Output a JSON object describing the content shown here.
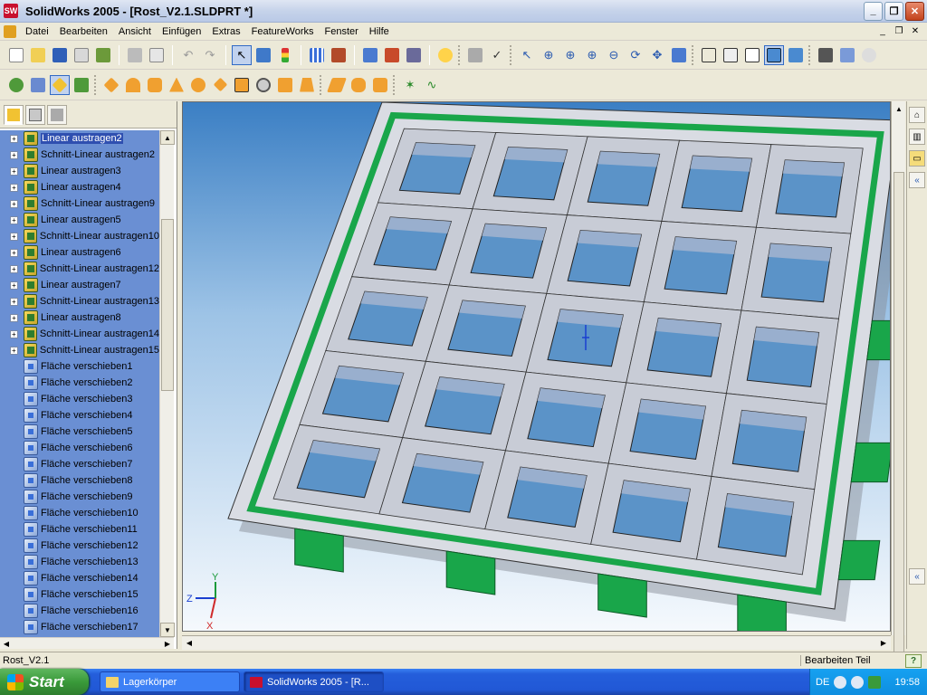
{
  "window": {
    "app_name": "SolidWorks 2005",
    "title": "SolidWorks 2005 - [Rost_V2.1.SLDPRT *]"
  },
  "menu": {
    "items": [
      "Datei",
      "Bearbeiten",
      "Ansicht",
      "Einfügen",
      "Extras",
      "FeatureWorks",
      "Fenster",
      "Hilfe"
    ]
  },
  "feature_tree": {
    "items": [
      {
        "label": "Linear austragen2",
        "expandable": true,
        "icon": "extrude-icon",
        "highlight": true
      },
      {
        "label": "Schnitt-Linear austragen2",
        "expandable": true,
        "icon": "cut-extrude-icon"
      },
      {
        "label": "Linear austragen3",
        "expandable": true,
        "icon": "extrude-icon"
      },
      {
        "label": "Linear austragen4",
        "expandable": true,
        "icon": "extrude-icon"
      },
      {
        "label": "Schnitt-Linear austragen9",
        "expandable": true,
        "icon": "cut-extrude-icon"
      },
      {
        "label": "Linear austragen5",
        "expandable": true,
        "icon": "extrude-icon"
      },
      {
        "label": "Schnitt-Linear austragen10",
        "expandable": true,
        "icon": "cut-extrude-icon"
      },
      {
        "label": "Linear austragen6",
        "expandable": true,
        "icon": "extrude-icon"
      },
      {
        "label": "Schnitt-Linear austragen12",
        "expandable": true,
        "icon": "cut-extrude-icon"
      },
      {
        "label": "Linear austragen7",
        "expandable": true,
        "icon": "extrude-icon"
      },
      {
        "label": "Schnitt-Linear austragen13",
        "expandable": true,
        "icon": "cut-extrude-icon"
      },
      {
        "label": "Linear austragen8",
        "expandable": true,
        "icon": "extrude-icon"
      },
      {
        "label": "Schnitt-Linear austragen14",
        "expandable": true,
        "icon": "cut-extrude-icon"
      },
      {
        "label": "Schnitt-Linear austragen15",
        "expandable": true,
        "icon": "cut-extrude-icon"
      },
      {
        "label": "Fläche verschieben1",
        "expandable": false,
        "icon": "move-face-icon"
      },
      {
        "label": "Fläche verschieben2",
        "expandable": false,
        "icon": "move-face-icon"
      },
      {
        "label": "Fläche verschieben3",
        "expandable": false,
        "icon": "move-face-icon"
      },
      {
        "label": "Fläche verschieben4",
        "expandable": false,
        "icon": "move-face-icon"
      },
      {
        "label": "Fläche verschieben5",
        "expandable": false,
        "icon": "move-face-icon"
      },
      {
        "label": "Fläche verschieben6",
        "expandable": false,
        "icon": "move-face-icon"
      },
      {
        "label": "Fläche verschieben7",
        "expandable": false,
        "icon": "move-face-icon"
      },
      {
        "label": "Fläche verschieben8",
        "expandable": false,
        "icon": "move-face-icon"
      },
      {
        "label": "Fläche verschieben9",
        "expandable": false,
        "icon": "move-face-icon"
      },
      {
        "label": "Fläche verschieben10",
        "expandable": false,
        "icon": "move-face-icon"
      },
      {
        "label": "Fläche verschieben11",
        "expandable": false,
        "icon": "move-face-icon"
      },
      {
        "label": "Fläche verschieben12",
        "expandable": false,
        "icon": "move-face-icon"
      },
      {
        "label": "Fläche verschieben13",
        "expandable": false,
        "icon": "move-face-icon"
      },
      {
        "label": "Fläche verschieben14",
        "expandable": false,
        "icon": "move-face-icon"
      },
      {
        "label": "Fläche verschieben15",
        "expandable": false,
        "icon": "move-face-icon"
      },
      {
        "label": "Fläche verschieben16",
        "expandable": false,
        "icon": "move-face-icon"
      },
      {
        "label": "Fläche verschieben17",
        "expandable": false,
        "icon": "move-face-icon"
      }
    ]
  },
  "viewport": {
    "model": "grate-part",
    "accent_green": "#19a64a",
    "axes": {
      "x": "X",
      "y": "Y",
      "z": "Z"
    }
  },
  "statusbar": {
    "left": "Rost_V2.1",
    "right": "Bearbeiten Teil",
    "help_icon": "?"
  },
  "taskbar": {
    "start_label": "Start",
    "tasks": [
      {
        "label": "Lagerkörper",
        "icon": "folder-icon",
        "active": false
      },
      {
        "label": "SolidWorks 2005 - [R...",
        "icon": "solidworks-icon",
        "active": true
      }
    ],
    "tray": {
      "lang": "DE",
      "time": "19:58"
    }
  }
}
